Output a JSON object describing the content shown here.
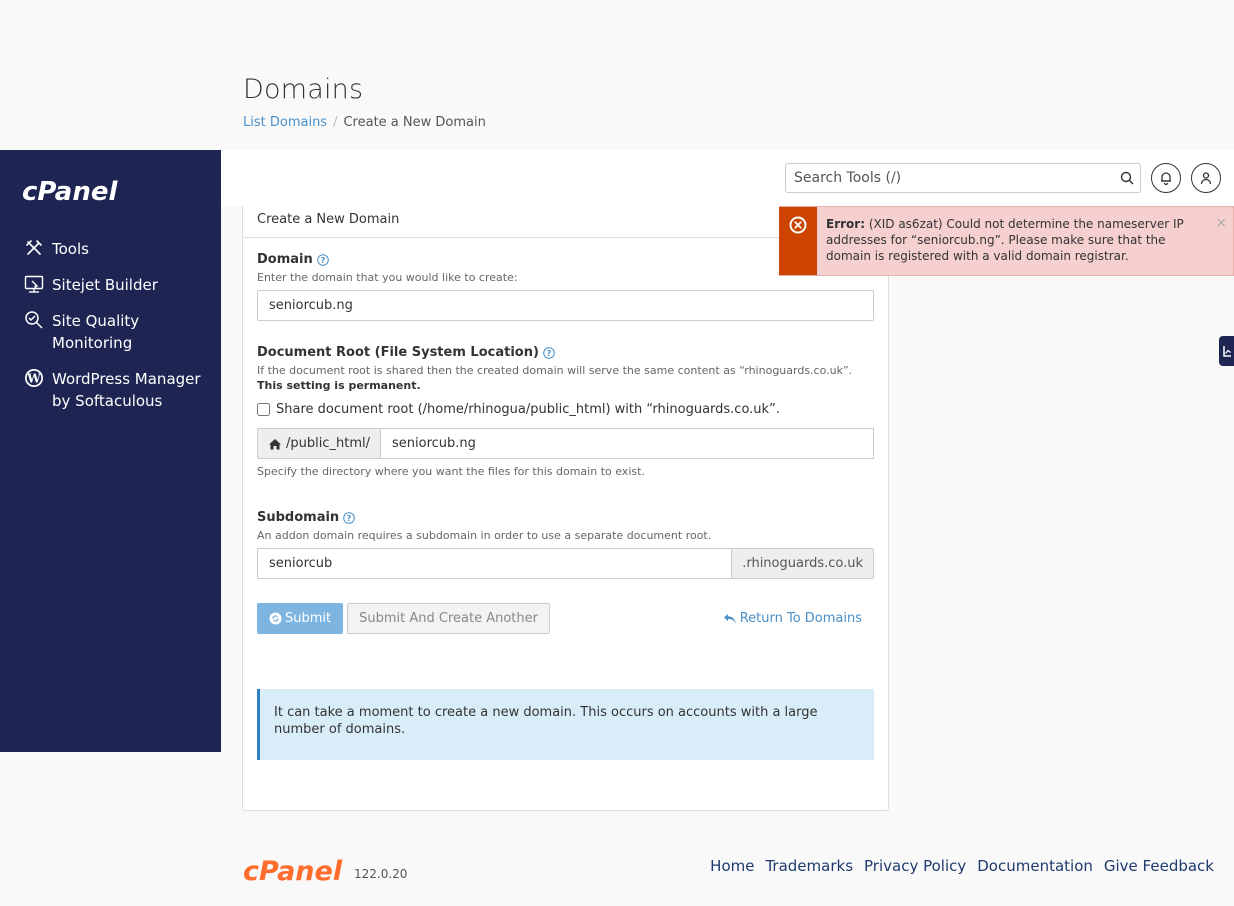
{
  "header": {
    "title": "Domains",
    "breadcrumb": {
      "link": "List Domains",
      "current": "Create a New Domain"
    }
  },
  "sidebar": {
    "logo_text": "cPanel",
    "items": [
      {
        "label": "Tools",
        "icon": "tools-icon"
      },
      {
        "label": "Sitejet Builder",
        "icon": "sitejet-icon"
      },
      {
        "label": "Site Quality Monitoring",
        "icon": "site-quality-icon"
      },
      {
        "label": "WordPress Manager by Softaculous",
        "icon": "wordpress-icon"
      }
    ]
  },
  "topbar": {
    "search_placeholder": "Search Tools (/)"
  },
  "form": {
    "heading": "Create a New Domain",
    "domain": {
      "label": "Domain",
      "help": "Enter the domain that you would like to create:",
      "value": "seniorcub.ng"
    },
    "docroot": {
      "label": "Document Root (File System Location)",
      "help": "If the document root is shared then the created domain will serve the same content as “rhinoguards.co.uk”.",
      "permanent": "This setting is permanent.",
      "share_label": "Share document root (/home/rhinogua/public_html) with “rhinoguards.co.uk”.",
      "prefix": "/public_html/",
      "value": "seniorcub.ng",
      "hint": "Specify the directory where you want the files for this domain to exist."
    },
    "subdomain": {
      "label": "Subdomain",
      "help": "An addon domain requires a subdomain in order to use a separate document root.",
      "value": "seniorcub",
      "suffix": ".rhinoguards.co.uk"
    },
    "buttons": {
      "submit": "Submit",
      "submit_another": "Submit And Create Another",
      "return": "Return To Domains"
    },
    "info": "It can take a moment to create a new domain. This occurs on accounts with a large number of domains."
  },
  "alert": {
    "title": "Error:",
    "message": "(XID as6zat) Could not determine the nameserver IP addresses for “seniorcub.ng”. Please make sure that the domain is registered with a valid domain registrar.",
    "close": "×"
  },
  "footer": {
    "logo_text": "cPanel",
    "version": "122.0.20",
    "links": [
      "Home",
      "Trademarks",
      "Privacy Policy",
      "Documentation",
      "Give Feedback"
    ]
  },
  "colors": {
    "sidebar_bg": "#1e2553",
    "link": "#4a90c9",
    "brand_orange": "#ff6c2c",
    "error": "#cc4400",
    "error_bg": "#f5d0cf",
    "info_bg": "#d9edf8"
  }
}
